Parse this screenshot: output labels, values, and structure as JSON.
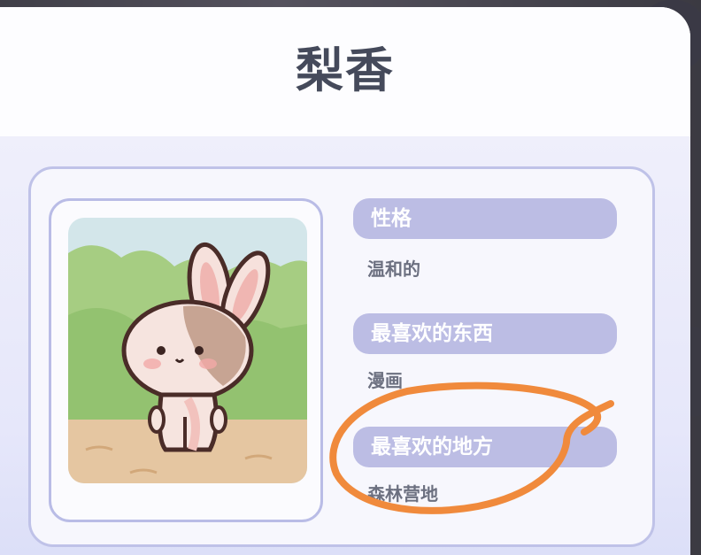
{
  "character": {
    "name": "梨香",
    "portrait_icon": "bunny-portrait-icon"
  },
  "attributes": [
    {
      "label": "性格",
      "value": "温和的"
    },
    {
      "label": "最喜欢的东西",
      "value": "漫画"
    },
    {
      "label": "最喜欢的地方",
      "value": "森林营地"
    }
  ],
  "colors": {
    "title": "#454a5b",
    "label_bg": "#bcbde4",
    "panel_border": "#bfc2e8",
    "annotation_stroke": "#f08a3c"
  }
}
